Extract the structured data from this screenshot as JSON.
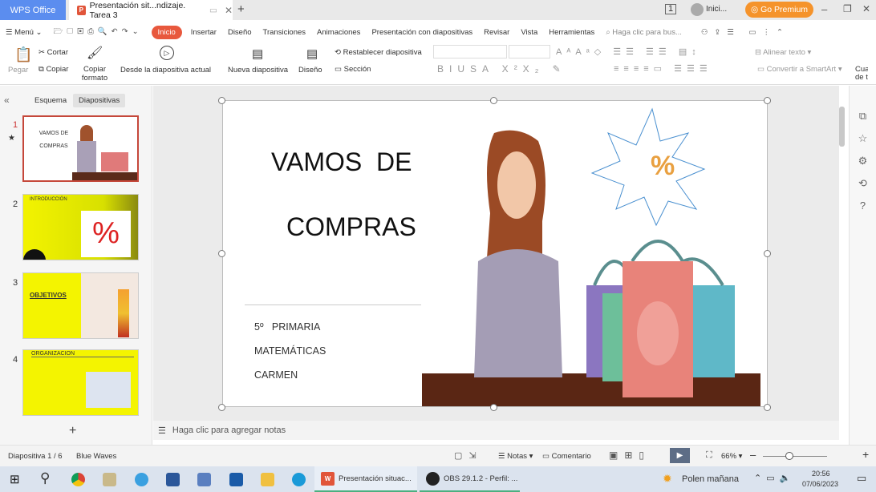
{
  "tabs": {
    "wps": "WPS Office",
    "document": "Presentación sit...ndizaje. Tarea 3",
    "new_tab": "+"
  },
  "titlebar": {
    "login": "Inici...",
    "premium": "Go Premium"
  },
  "menu": {
    "menu": "Menú",
    "items": [
      "Inicio",
      "Insertar",
      "Diseño",
      "Transiciones",
      "Animaciones",
      "Presentación con diapositivas",
      "Revisar",
      "Vista",
      "Herramientas"
    ],
    "search_placeholder": "Haga clic para bus..."
  },
  "ribbon": {
    "paste": "Pegar",
    "cut": "Cortar",
    "copy": "Copiar",
    "format_painter": "Copiar formato",
    "from_current": "Desde la diapositiva actual",
    "new_slide": "Nueva diapositiva",
    "layout": "Diseño",
    "reset": "Restablecer diapositiva",
    "section": "Sección",
    "align_text": "Alinear texto",
    "smartart": "Convertir a SmartArt",
    "textbox": "Cua de t"
  },
  "panel": {
    "tabs": [
      "Esquema",
      "Diapositivas"
    ],
    "active_tab": "Diapositivas"
  },
  "thumbnails": [
    {
      "num": "1",
      "title": "VAMOS DE COMPRAS"
    },
    {
      "num": "2",
      "title": "INTRODUCCIÓN"
    },
    {
      "num": "3",
      "title": "OBJETIVOS"
    },
    {
      "num": "4",
      "title": "ORGANIZACION"
    }
  ],
  "slide": {
    "title_line1": "VAMOS  DE",
    "title_line2": "COMPRAS",
    "lines": [
      "5º   PRIMARIA",
      "MATEMÁTICAS",
      "CARMEN"
    ],
    "badge": "%"
  },
  "notes_placeholder": "Haga clic para agregar notas",
  "status": {
    "slide": "Diapositiva  1 / 6",
    "theme": "Blue Waves",
    "notes": "Notas",
    "comment": "Comentario",
    "zoom": "66%"
  },
  "taskbar": {
    "app1": "Presentación situac...",
    "app2": "OBS 29.1.2 - Perfil: ...",
    "weather": "Polen mañana",
    "time": "20:56",
    "date": "07/06/2023"
  }
}
